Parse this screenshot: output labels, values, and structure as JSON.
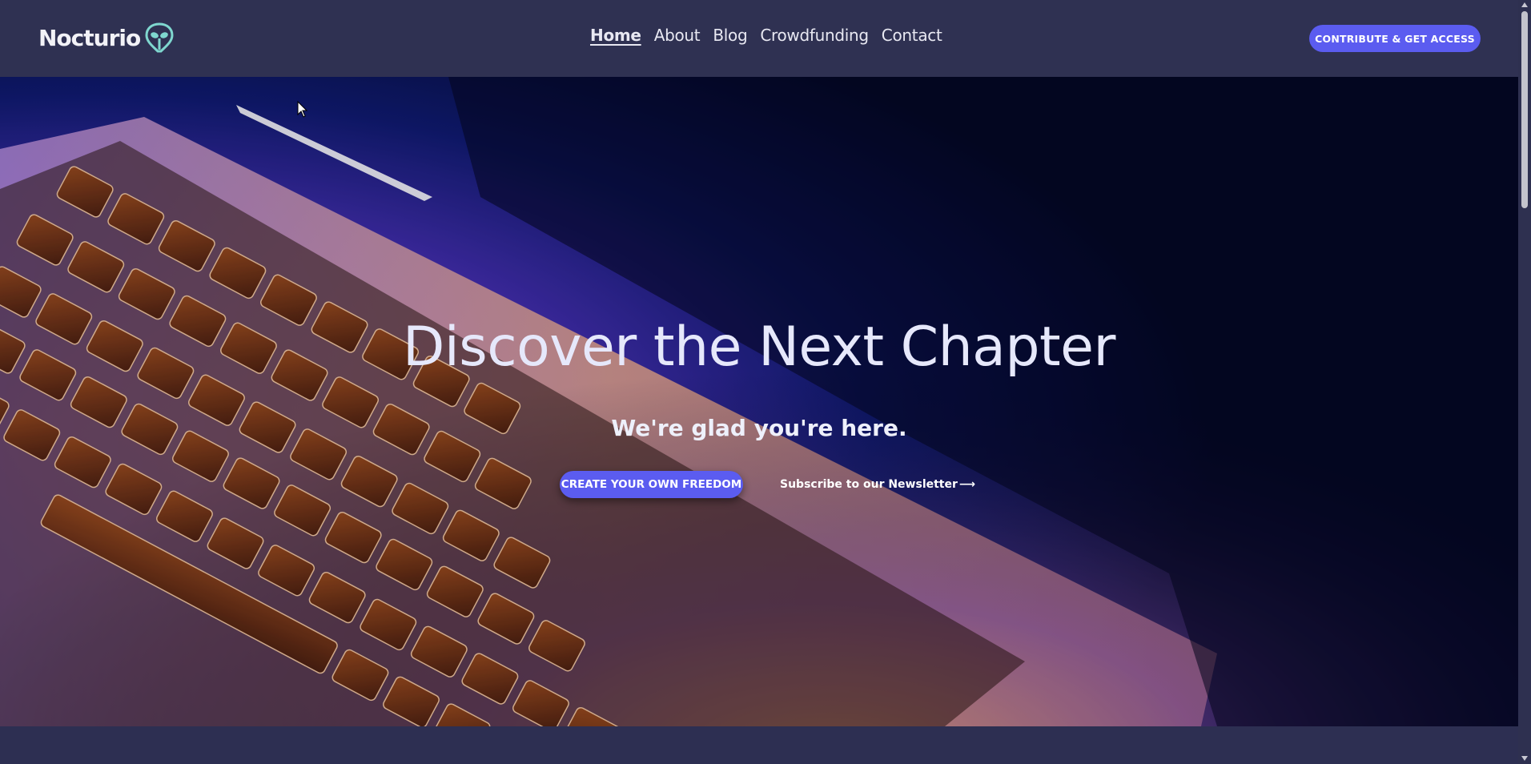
{
  "site": {
    "logo_text": "Nocturio",
    "logo_icon": "alien-head-icon"
  },
  "nav": {
    "items": [
      {
        "label": "Home",
        "active": true
      },
      {
        "label": "About",
        "active": false
      },
      {
        "label": "Blog",
        "active": false
      },
      {
        "label": "Crowdfunding",
        "active": false
      },
      {
        "label": "Contact",
        "active": false
      }
    ],
    "cta_label": "CONTRIBUTE & GET ACCESS"
  },
  "hero": {
    "title": "Discover the Next Chapter",
    "subtitle": "We're glad you're here.",
    "primary_button": "CREATE YOUR OWN FREEDOM",
    "newsletter_link": "Subscribe to our Newsletter",
    "newsletter_arrow": "⟶",
    "background_image": "backlit-laptop-keyboard-photo"
  },
  "colors": {
    "header_bg": "#2f3152",
    "accent": "#5b5cf0",
    "hero_dark": "#050a2a",
    "text_light": "#e6e8fb"
  }
}
